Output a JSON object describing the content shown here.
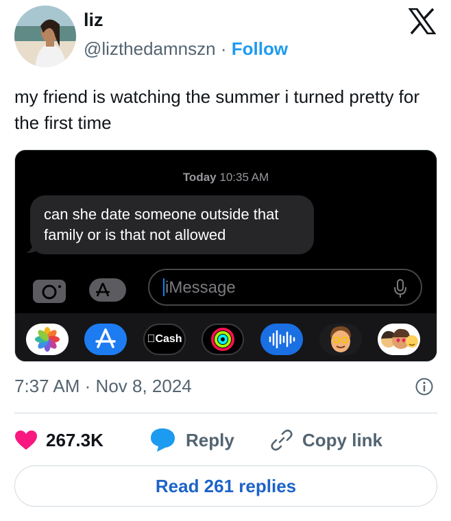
{
  "author": {
    "name": "liz",
    "handle": "@lizthedamnszn",
    "separator": "·",
    "follow_label": "Follow"
  },
  "tweet": {
    "text": "my friend is watching the summer i turned pretty for the first time"
  },
  "media": {
    "timestamp_day": "Today",
    "timestamp_time": "10:35 AM",
    "bubble_text": "can she date someone outside that family or is that not allowed",
    "input_placeholder": "iMessage",
    "cash_label": "Cash",
    "apps": [
      "photos-icon",
      "app-store-icon",
      "apple-cash-icon",
      "fitness-icon",
      "audio-message-icon",
      "memoji-icon",
      "memoji-stickers-icon"
    ]
  },
  "meta": {
    "time": "7:37 AM",
    "separator": "·",
    "date": "Nov 8, 2024"
  },
  "actions": {
    "like_count": "267.3K",
    "reply_label": "Reply",
    "copy_label": "Copy link"
  },
  "read_replies_label": "Read 261 replies",
  "colors": {
    "accent": "#1d9bf0",
    "like": "#f91880",
    "text_secondary": "#536471"
  }
}
